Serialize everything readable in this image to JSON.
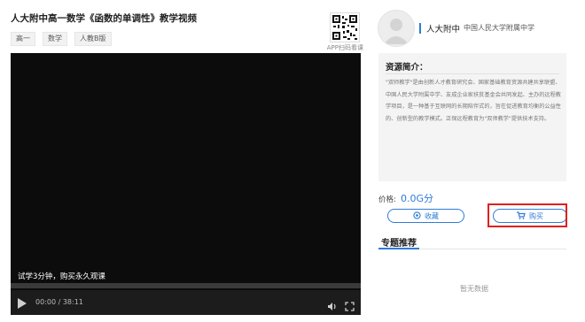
{
  "course": {
    "title": "人大附中高一数学《函数的单调性》教学视频",
    "tags": [
      "高一",
      "数学",
      "人教B版"
    ]
  },
  "qr": {
    "label": "APP扫码看课"
  },
  "player": {
    "trial_text": "试学3分钟，购买永久观课",
    "time": "00:00 / 38:11",
    "progress": 0
  },
  "teacher": {
    "short": "人大附中",
    "full": "中国人民大学附属中学"
  },
  "intro": {
    "title": "资源简介：",
    "text": "\"双师教学\"是由创新人才教育研究会、国家基础教育资源共建共享联盟、中国人民大学附属中学、友成企业家扶贫基金会共同发起、主办的远程教学项目，是一种基于互联网的长期陪伴式的，旨在促进教育均衡的公益性的、创新型的教学模式。正保远程教育为\"双师教学\"提供技术支持。"
  },
  "purchase": {
    "price_label": "价格:",
    "price_value": "0.0G分",
    "fav_label": "收藏",
    "buy_label": "购买"
  },
  "recommend": {
    "title": "专题推荐",
    "empty": "暂无数据"
  },
  "colors": {
    "accent": "#2f7bd9",
    "highlight": "#e0201c"
  }
}
